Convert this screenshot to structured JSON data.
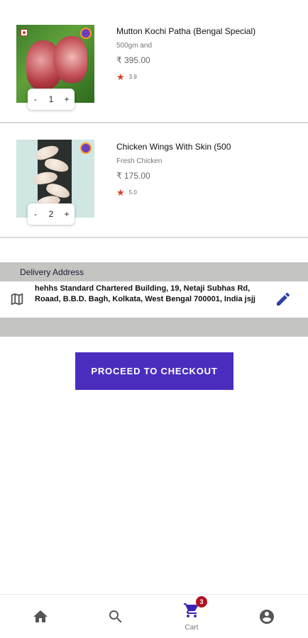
{
  "cart_items": [
    {
      "title": "Mutton Kochi Patha (Bengal Special)",
      "subtitle": "500gm and",
      "price": "₹ 395.00",
      "rating": "3.9",
      "quantity": "1",
      "minus_label": "-",
      "plus_label": "+"
    },
    {
      "title": "Chicken Wings With Skin (500",
      "subtitle": "Fresh Chicken",
      "price": "₹ 175.00",
      "rating": "5.0",
      "quantity": "2",
      "minus_label": "-",
      "plus_label": "+"
    }
  ],
  "delivery": {
    "header": "Delivery Address",
    "address": "hehhs Standard Chartered Building, 19, Netaji Subhas Rd, Roaad, B.B.D. Bagh, Kolkata, West Bengal 700001, India jsjj"
  },
  "checkout": {
    "label": "PROCEED TO CHECKOUT"
  },
  "bottom_nav": {
    "items": [
      {
        "icon": "home-icon",
        "label": ""
      },
      {
        "icon": "search-icon",
        "label": ""
      },
      {
        "icon": "cart-icon",
        "label": "Cart",
        "badge": "3"
      },
      {
        "icon": "account-icon",
        "label": ""
      }
    ]
  },
  "colors": {
    "accent": "#4a2dbe",
    "star": "#e23b1e",
    "badge": "#b0131f",
    "edit_icon": "#2c3ea8",
    "section_bg": "#c4c4c0"
  }
}
